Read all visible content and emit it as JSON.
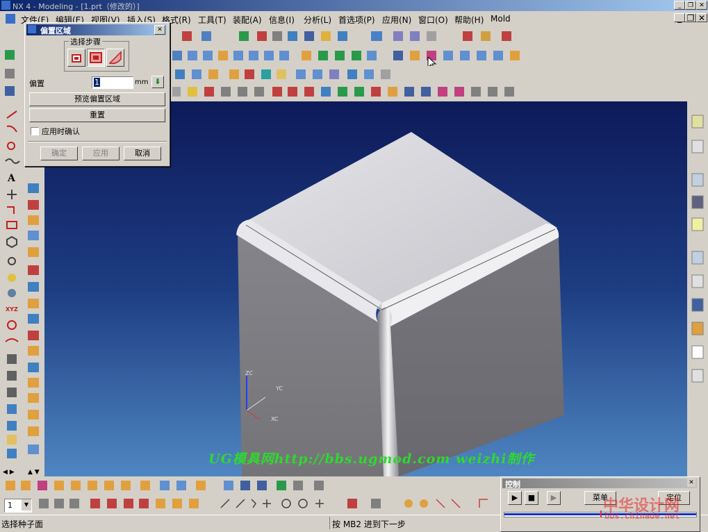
{
  "window": {
    "title": "NX 4 - Modeling - [1.prt（修改的）]"
  },
  "menu": [
    {
      "label": "文件(F)"
    },
    {
      "label": "编辑(E)"
    },
    {
      "label": "视图(V)"
    },
    {
      "label": "插入(S)"
    },
    {
      "label": "格式(R)"
    },
    {
      "label": "工具(T)"
    },
    {
      "label": "装配(A)"
    },
    {
      "label": "信息(I)"
    },
    {
      "label": "分析(L)"
    },
    {
      "label": "首选项(P)"
    },
    {
      "label": "应用(N)"
    },
    {
      "label": "窗口(O)"
    },
    {
      "label": "帮助(H)"
    },
    {
      "label": "Mold"
    }
  ],
  "dialog": {
    "title": "偏置区域",
    "steps_label": "选择步骤",
    "offset_label": "偏置",
    "offset_value": "1",
    "unit": "mm",
    "preview_button": "预览偏置区域",
    "reset_button": "重置",
    "confirm_on_apply": "应用时确认",
    "confirm_on_apply_checked": false,
    "ok_button": "确定",
    "apply_button": "应用",
    "cancel_button": "取消"
  },
  "viewport": {
    "axes": {
      "z": "ZC",
      "y": "YC",
      "x": "XC"
    },
    "colors": {
      "bg_top": "#0d1a5a",
      "bg_bottom": "#4f86c2",
      "top_face": "#d2d2d6",
      "front_face": "#7e7e84",
      "side_face": "#6e6e74"
    }
  },
  "watermark": {
    "text": "UG模具网http://bbs.ugmod.com weizhi制作",
    "color": "#2fd92f"
  },
  "watermark2": {
    "line1": "中华设计网",
    "line2": "bbs.chinade.net"
  },
  "control_panel": {
    "title": "控制",
    "menu_button": "菜单",
    "locate_button": "定位"
  },
  "bottom_toolbar": {
    "layer_value": "1"
  },
  "status": {
    "left": "选择种子面",
    "right": "按 MB2 进到下一步"
  }
}
